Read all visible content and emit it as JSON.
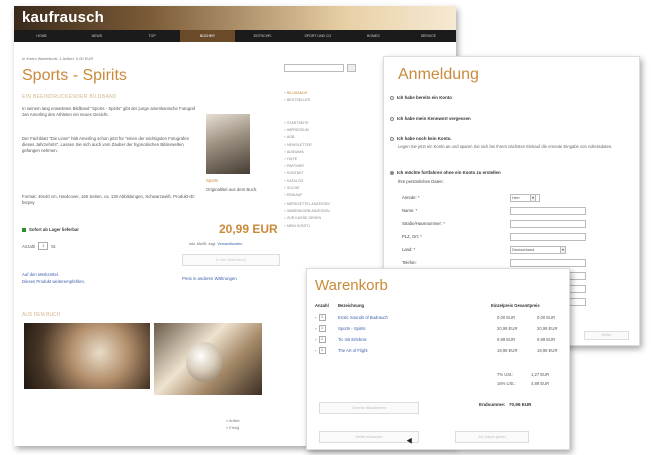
{
  "shop": {
    "logo": "kaufrausch",
    "nav": [
      "HOME",
      "NEWS",
      "TOP",
      "BÜCHER",
      "ZEITSCHR.",
      "SPORT UND CO",
      "HOMES",
      "SERVICE"
    ],
    "nav_active_index": 3,
    "breadcrumb": "In Ihrem Warenkorb: 1 Artikel, 0,00 EUR",
    "title": "Sports - Spirits",
    "subtitle": "EIN BEEINDRUCKENDER BILDBAND",
    "desc1": "In seinem lang erwarteten Bildband \"Sports - Spirits\" gibt der junge amerikanische Fotograf Jan Amerling den Athleten ein neues Gesicht.",
    "desc2": "Der Fachblatt \"Die Linse\" hält Amerling schon jetzt für \"einen der wichtigsten Fotografen dieses Jahrzehnts\". Lassen Sie sich auch vom Zauber der hypnotischen Bilderwelten gefangen nehmen.",
    "desc3": "Format: 40x40 cm, Hardcover, 160 Seiten, ca. 130 Abbildungen, Schwarzweiß. Produkt-ID: bsrpsy",
    "stock": "Sofort ab Lager lieferbar",
    "qty_label": "Anzahl",
    "qty_value": "1",
    "qty_unit": "St.",
    "link_similar": "Auf den Merkzettel.",
    "link_recommend": "Dieses Produkt weiterempfehlen.",
    "link_currency": "Preis in anderen Währungen",
    "product_cat": "Sports",
    "product_caption": "Originaltitel aus dem Buch.",
    "price": "20,99 EUR",
    "vat_prefix": "inkl. MwSt. zzgl.",
    "vat_link": "Versandkosten",
    "cart_button": "In den Warenkorb",
    "in_book": "AUS DEM BUCH",
    "legend1": "» Artikel",
    "legend2": "» Erfolg",
    "sidebar1": [
      "BILDBÄNDE",
      "BESTSELLER"
    ],
    "sidebar2": [
      "STARTSEITE",
      "IMPRESSUM",
      "AGB",
      "NEWSLETTER",
      "AUSWAHL",
      "HILFE",
      "PARTNER",
      "KONTAKT",
      "KATALOG",
      "SUCHE",
      "EINKAUF"
    ],
    "sidebar3": [
      "MERKZETTEL ANZEIGEN",
      "WARENKORB ANZEIGEN",
      "ZUR KASSE GEHEN",
      "MEIN KONTO"
    ]
  },
  "login": {
    "title": "Anmeldung",
    "opt1": "Ich habe bereits ein Konto",
    "opt2": "Ich habe mein Kennwort vergessen",
    "opt3": "Ich habe noch kein Konto.",
    "opt3_desc": "Legen Sie jetzt ein Konto an und sparen Sie sich bei Ihrem nächsten Einkauf die erneute Eingabe von Adressdaten.",
    "opt4": "Ich möchte fortfahren ohne ein Konto zu erstellen",
    "personal": "Ihre persönlichen Daten:",
    "f_anrede": "Anrede: *",
    "f_anrede_val": "Herr",
    "f_name": "Name: *",
    "f_strasse": "Straße/Hausnummer: *",
    "f_plz": "PLZ, Ort: *",
    "f_land": "Land: *",
    "f_land_val": "Deutschland",
    "f_telefon": "Telefon:",
    "weiter": "Weiter"
  },
  "cart": {
    "title": "Warenkorb",
    "col_qty": "Anzahl",
    "col_name": "Bezeichnung",
    "col_price": "Einzelpreis Gesamtpreis",
    "items": [
      {
        "qty": "1",
        "name": "Erotic Sounds of Budrauch",
        "unit": "0,00 EUR",
        "total": "0,00 EUR"
      },
      {
        "qty": "1",
        "name": "Sports - Spirits",
        "unit": "20,99 EUR",
        "total": "20,99 EUR"
      },
      {
        "qty": "1",
        "name": "Tic mit Erlebnis",
        "unit": "9,99 EUR",
        "total": "9,99 EUR"
      },
      {
        "qty": "1",
        "name": "The Art of Flight",
        "unit": "19,99 EUR",
        "total": "19,99 EUR"
      }
    ],
    "sum1_label": "7% USt.:",
    "sum1_val": "1,27 EUR",
    "sum2_label": "16% USt.:",
    "sum2_val": "4,89 EUR",
    "total_label": "Endsumme:",
    "total_val": "70,96 EUR",
    "btn_recalc": "Summe aktualisieren",
    "btn_continue": "Weiter einkaufen",
    "btn_checkout": "Zur Kasse gehen"
  }
}
